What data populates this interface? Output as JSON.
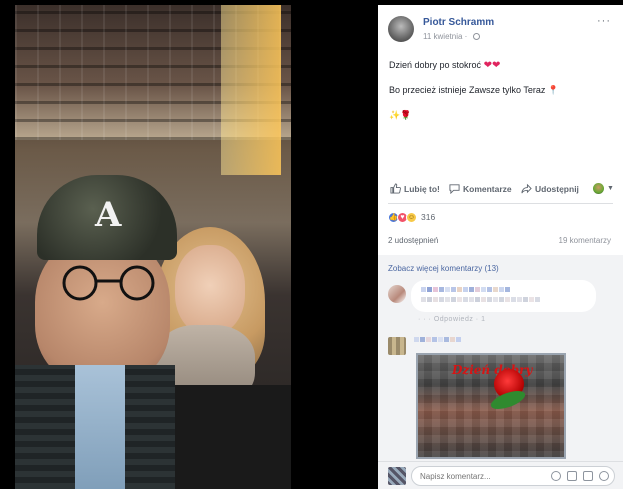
{
  "post": {
    "author": "Piotr Schramm",
    "date": "11 kwietnia",
    "more": "···",
    "line1": "Dzień dobry po stokroć",
    "line1_hearts": "❤❤",
    "line2": "Bo przecież istnieje Zawsze tylko Teraz",
    "line2_pin": "📍",
    "line3_emoji": "✨🌹",
    "icons": [
      "globe-icon",
      "heart-emoji",
      "pin-emoji",
      "sparkles-emoji",
      "rose-emoji"
    ]
  },
  "actions": {
    "like": "Lubię to!",
    "comment": "Komentarze",
    "share": "Udostępnij",
    "caret": "▼"
  },
  "stats": {
    "reaction_count": "316",
    "shares": "2 udostępnień",
    "comments": "19 komentarzy"
  },
  "comments": {
    "see_more": "Zobacz więcej komentarzy (13)",
    "c1_meta": "· · · Odpowiedz · 1",
    "input_placeholder": "Napisz komentarz..."
  },
  "sticker": {
    "text": "Dzień dobry"
  },
  "colors": {
    "link": "#365899",
    "muted": "#90949c",
    "like_blue": "#4a76d8",
    "love_red": "#f25268"
  }
}
